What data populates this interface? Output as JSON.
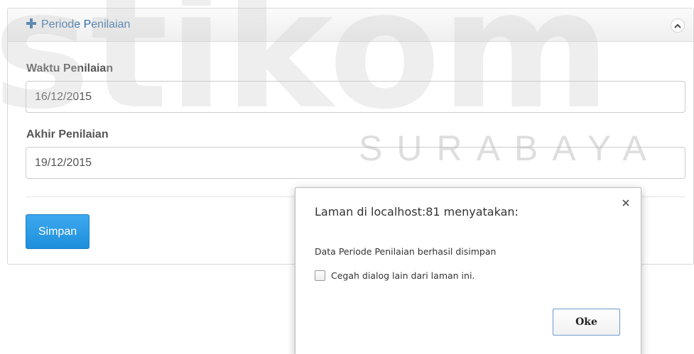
{
  "watermark": {
    "logo_text": "stikom",
    "city_text": "SURABAYA"
  },
  "panel": {
    "title": "Periode Penilaian",
    "fields": [
      {
        "label": "Waktu Penilaian",
        "value": "16/12/2015"
      },
      {
        "label": "Akhir Penilaian",
        "value": "19/12/2015"
      }
    ],
    "save_label": "Simpan"
  },
  "dialog": {
    "title": "Laman di localhost:81 menyatakan:",
    "message": "Data Periode Penilaian berhasil disimpan",
    "checkbox_label": "Cegah dialog lain dari laman ini.",
    "ok_label": "Oke"
  },
  "colors": {
    "title_blue": "#2f6ca6",
    "button_blue": "#2196e6"
  },
  "icons": {
    "title": "plus-icon",
    "collapse": "chevron-up-icon",
    "close": "close-icon"
  }
}
